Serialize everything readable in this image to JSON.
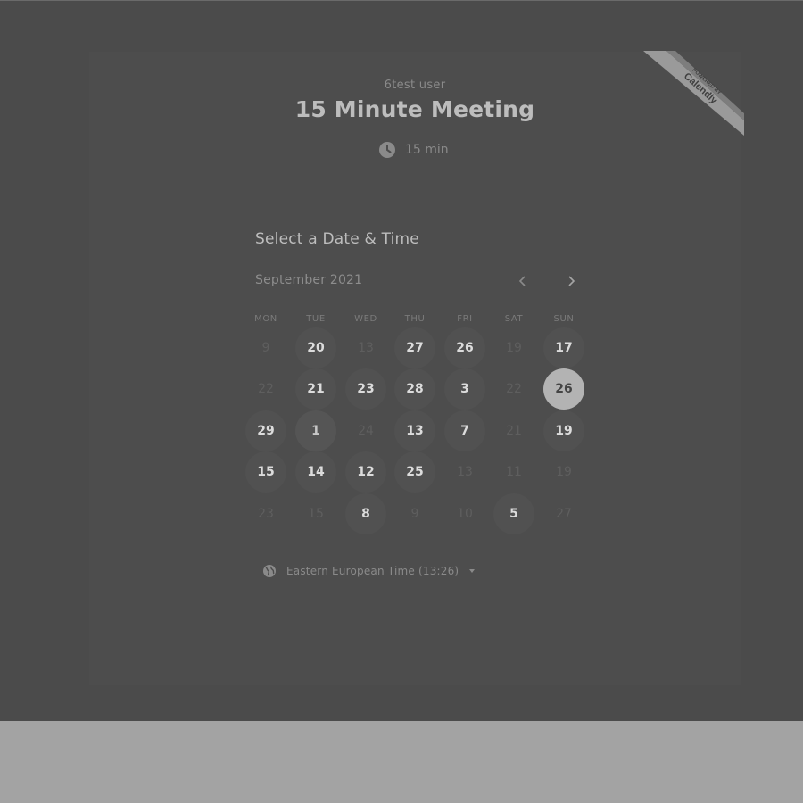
{
  "event": {
    "host": "6test user",
    "title": "15 Minute Meeting",
    "duration": "15 min",
    "icon": "clock-icon"
  },
  "branding": {
    "line1": "POWERED BY",
    "line2": "Calendly"
  },
  "scheduler": {
    "heading": "Select a Date & Time",
    "month_label": "September 2021",
    "prev_icon": "chevron-left-icon",
    "next_icon": "chevron-right-icon",
    "weekdays": [
      "MON",
      "TUE",
      "WED",
      "THU",
      "FRI",
      "SAT",
      "SUN"
    ],
    "weeks": [
      [
        {
          "label": "9",
          "state": "unavailable"
        },
        {
          "label": "20",
          "state": "available"
        },
        {
          "label": "13",
          "state": "unavailable"
        },
        {
          "label": "27",
          "state": "available"
        },
        {
          "label": "26",
          "state": "available"
        },
        {
          "label": "19",
          "state": "unavailable"
        },
        {
          "label": "17",
          "state": "available"
        }
      ],
      [
        {
          "label": "22",
          "state": "unavailable"
        },
        {
          "label": "21",
          "state": "available"
        },
        {
          "label": "23",
          "state": "available"
        },
        {
          "label": "28",
          "state": "available"
        },
        {
          "label": "3",
          "state": "available"
        },
        {
          "label": "22",
          "state": "unavailable"
        },
        {
          "label": "26",
          "state": "selected"
        }
      ],
      [
        {
          "label": "29",
          "state": "available"
        },
        {
          "label": "1",
          "state": "today"
        },
        {
          "label": "24",
          "state": "unavailable"
        },
        {
          "label": "13",
          "state": "available"
        },
        {
          "label": "7",
          "state": "available"
        },
        {
          "label": "21",
          "state": "unavailable"
        },
        {
          "label": "19",
          "state": "available"
        }
      ],
      [
        {
          "label": "15",
          "state": "available"
        },
        {
          "label": "14",
          "state": "available"
        },
        {
          "label": "12",
          "state": "available"
        },
        {
          "label": "25",
          "state": "available"
        },
        {
          "label": "13",
          "state": "unavailable"
        },
        {
          "label": "11",
          "state": "unavailable"
        },
        {
          "label": "19",
          "state": "unavailable"
        }
      ],
      [
        {
          "label": "23",
          "state": "unavailable"
        },
        {
          "label": "15",
          "state": "unavailable"
        },
        {
          "label": "8",
          "state": "available"
        },
        {
          "label": "9",
          "state": "unavailable"
        },
        {
          "label": "10",
          "state": "unavailable"
        },
        {
          "label": "5",
          "state": "available"
        },
        {
          "label": "27",
          "state": "unavailable"
        }
      ]
    ]
  },
  "timezone": {
    "label": "Eastern European Time (13:26)",
    "icon": "globe-icon",
    "dropdown_icon": "caret-down-icon"
  },
  "colors": {
    "page_background": "#4b4b4b",
    "footer_background": "#a3a3a3",
    "selected_day": "#b3b3b3",
    "available_day": "#515151"
  }
}
